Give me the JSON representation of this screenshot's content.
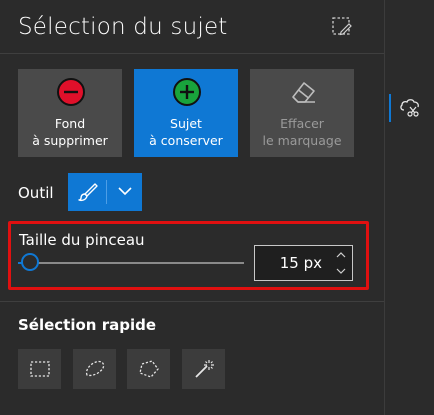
{
  "panel": {
    "title": "Sélection du sujet",
    "title_icon": "select-edit-icon"
  },
  "actions": [
    {
      "line1": "Fond",
      "line2": "à supprimer",
      "icon": "minus-circle-icon",
      "icon_color": "#e0102a",
      "state": "normal"
    },
    {
      "line1": "Sujet",
      "line2": "à conserver",
      "icon": "plus-circle-icon",
      "icon_color": "#19a33c",
      "state": "active"
    },
    {
      "line1": "Effacer",
      "line2": "le marquage",
      "icon": "eraser-icon",
      "state": "disabled"
    }
  ],
  "tool": {
    "label": "Outil",
    "selected": "brush-icon",
    "dropdown_icon": "chevron-down-icon"
  },
  "brush_size": {
    "label": "Taille du pinceau",
    "value_text": "15 px",
    "slider_fraction": 0.02
  },
  "quick_select": {
    "title": "Sélection rapide",
    "tools": [
      "rectangle-select-icon",
      "freeform-select-icon",
      "polygon-select-icon",
      "magic-wand-icon"
    ]
  },
  "rightbar": {
    "icon": "cloud-scissors-icon"
  },
  "colors": {
    "accent": "#0f78d4",
    "highlight": "#e01010",
    "background": "#2b2b2b"
  }
}
